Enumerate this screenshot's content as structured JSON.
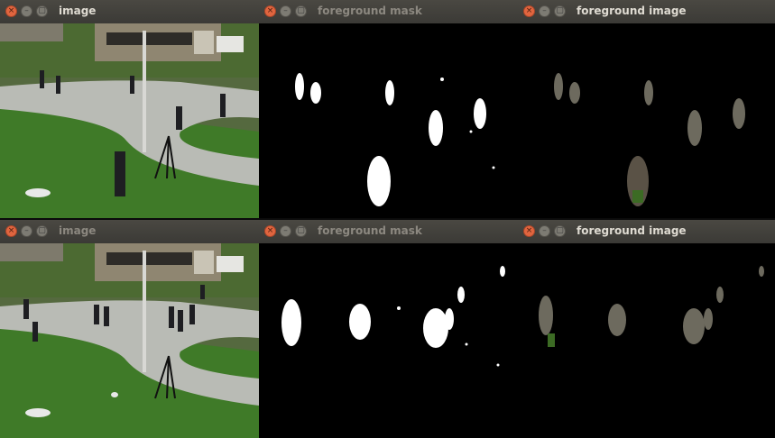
{
  "windows": {
    "top_left": {
      "title": "image"
    },
    "top_mid": {
      "title": "foreground mask"
    },
    "top_right": {
      "title": "foreground image"
    },
    "bottom_left": {
      "title": "image"
    },
    "bottom_mid": {
      "title": "foreground mask"
    },
    "bottom_right": {
      "title": "foreground image"
    }
  },
  "window_controls": {
    "close": "×",
    "minimize": "–",
    "maximize": "▢"
  },
  "colors": {
    "titlebar": "#3f3e3a",
    "close_button": "#e0653f",
    "grass": "#3f7a28",
    "path": "#b9bbb5",
    "building": "#8f8671",
    "mask": "#ffffff"
  }
}
